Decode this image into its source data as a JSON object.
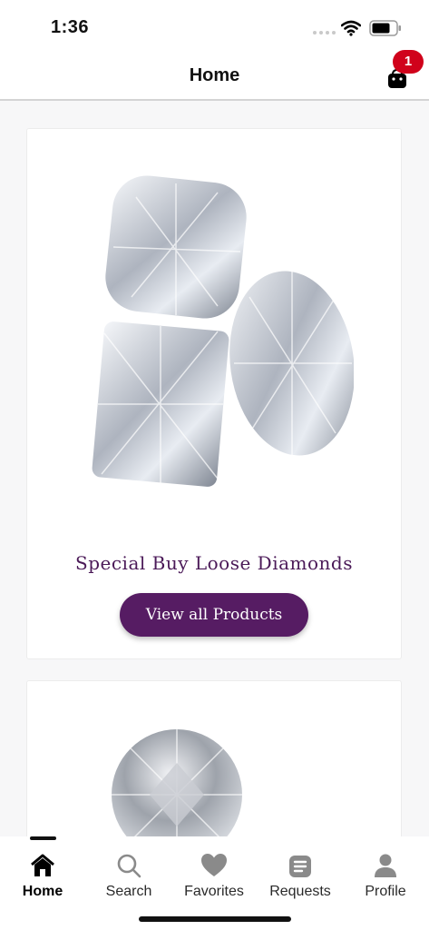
{
  "status_bar": {
    "time": "1:36"
  },
  "header": {
    "title": "Home",
    "cart_count": "1"
  },
  "cards": [
    {
      "title": "Special Buy Loose Diamonds",
      "button_label": "View all Products"
    }
  ],
  "tab_bar": {
    "active": "Home",
    "tabs": [
      {
        "label": "Home",
        "icon": "home-icon"
      },
      {
        "label": "Search",
        "icon": "search-icon"
      },
      {
        "label": "Favorites",
        "icon": "heart-icon"
      },
      {
        "label": "Requests",
        "icon": "document-icon"
      },
      {
        "label": "Profile",
        "icon": "user-icon"
      }
    ]
  },
  "colors": {
    "accent": "#561c63",
    "title": "#4b1a58",
    "badge": "#d0021b"
  }
}
